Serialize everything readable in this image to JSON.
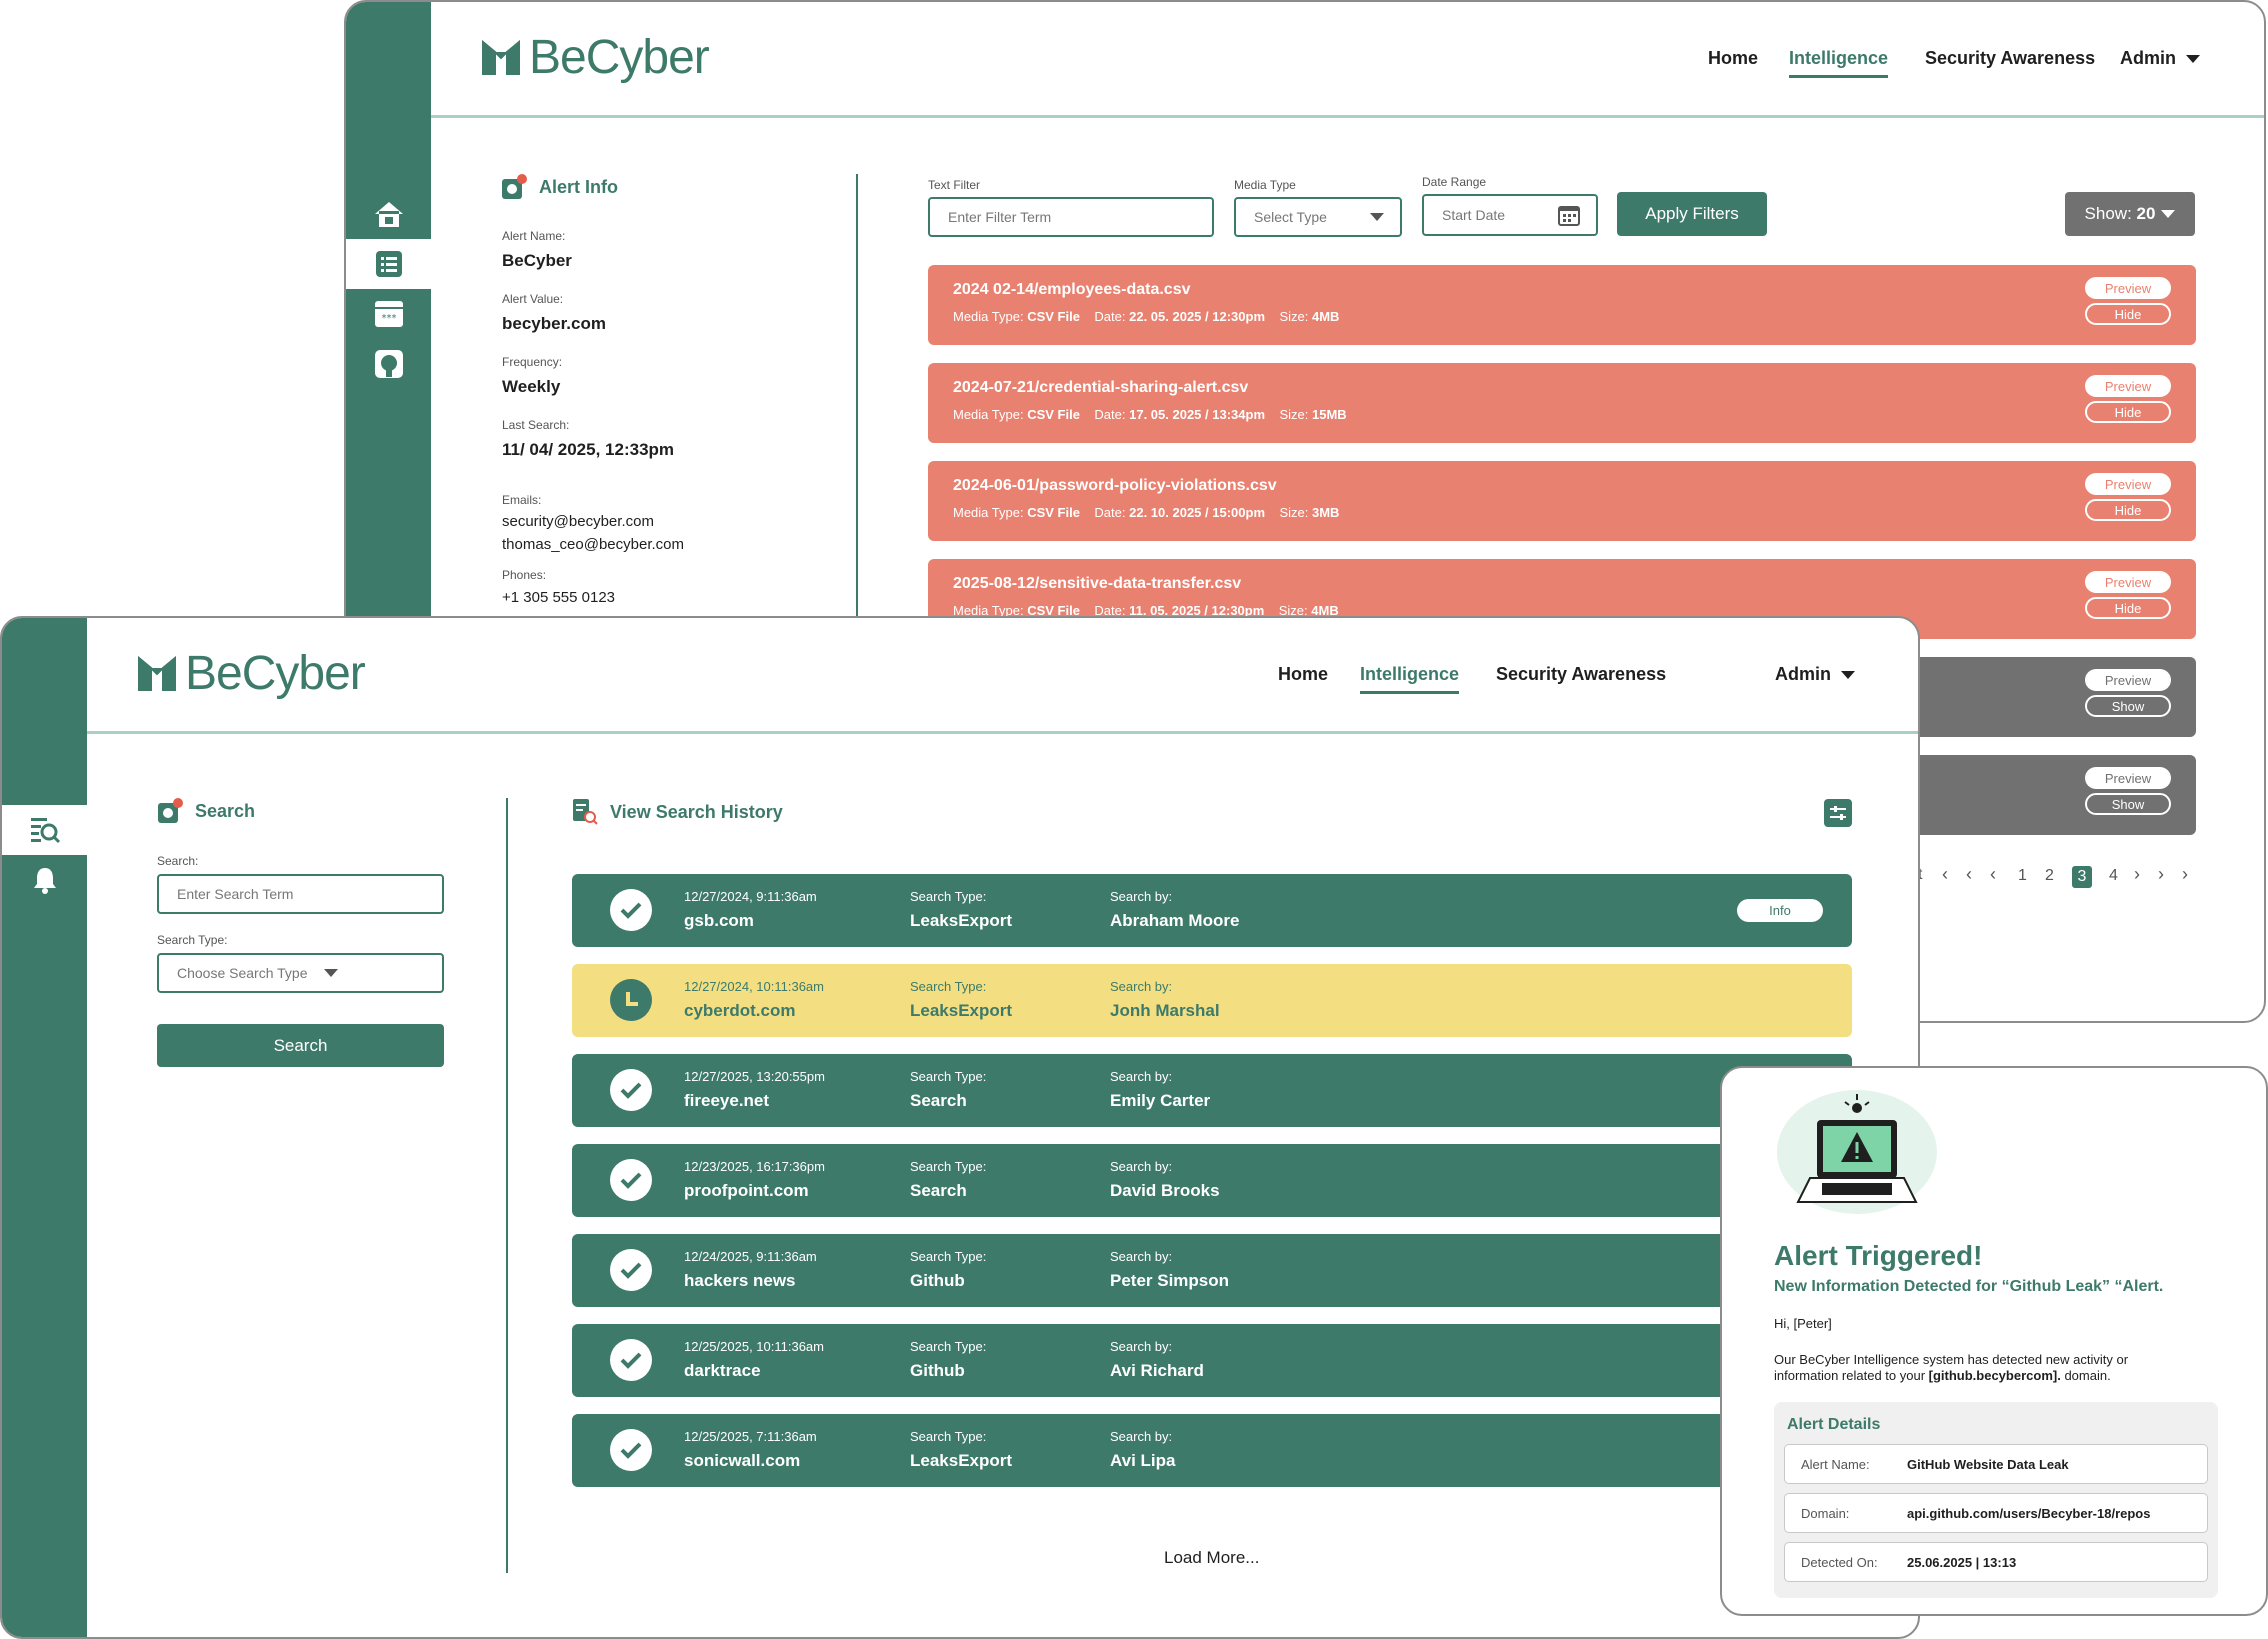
{
  "brand": "BeCyber",
  "nav": {
    "home": "Home",
    "intelligence": "Intelligence",
    "awareness": "Security Awareness",
    "admin": "Admin"
  },
  "alert_info": {
    "title": "Alert Info",
    "name_label": "Alert Name:",
    "name": "BeCyber",
    "value_label": "Alert Value:",
    "value": "becyber.com",
    "freq_label": "Frequency:",
    "freq": "Weekly",
    "last_label": "Last Search:",
    "last": "11/ 04/ 2025, 12:33pm",
    "emails_label": "Emails:",
    "email1": "security@becyber.com",
    "email2": "thomas_ceo@becyber.com",
    "phones_label": "Phones:",
    "phone1": "+1 305 555 0123"
  },
  "filters": {
    "text_label": "Text Filter",
    "text_placeholder": "Enter Filter Term",
    "media_label": "Media Type",
    "media_value": "Select Type",
    "date_label": "Date Range",
    "date_value": "Start Date",
    "apply": "Apply Filters",
    "show_label": "Show:",
    "show_value": "20"
  },
  "files": [
    {
      "name": "2024 02-14/employees-data.csv",
      "media_label": "Media Type:",
      "media": "CSV File",
      "date_label": "Date:",
      "date": "22. 05. 2025 / 12:30pm",
      "size_label": "Size:",
      "size": "4MB",
      "preview": "Preview",
      "action": "Hide"
    },
    {
      "name": "2024-07-21/credential-sharing-alert.csv",
      "media_label": "Media Type:",
      "media": "CSV File",
      "date_label": "Date:",
      "date": "17. 05. 2025 / 13:34pm",
      "size_label": "Size:",
      "size": "15MB",
      "preview": "Preview",
      "action": "Hide"
    },
    {
      "name": "2024-06-01/password-policy-violations.csv",
      "media_label": "Media Type:",
      "media": "CSV File",
      "date_label": "Date:",
      "date": "22. 10. 2025 / 15:00pm",
      "size_label": "Size:",
      "size": "3MB",
      "preview": "Preview",
      "action": "Hide"
    },
    {
      "name": "2025-08-12/sensitive-data-transfer.csv",
      "media_label": "Media Type:",
      "media": "CSV File",
      "date_label": "Date:",
      "date": "11. 05. 2025 / 12:30pm",
      "size_label": "Size:",
      "size": "4MB",
      "preview": "Preview",
      "action": "Hide"
    },
    {
      "preview": "Preview",
      "action": "Show"
    },
    {
      "preview": "Preview",
      "action": "Show"
    }
  ],
  "pagination": {
    "pages": [
      "1",
      "2",
      "3",
      "4"
    ],
    "current": "3",
    "partial": "t"
  },
  "search": {
    "title": "Search",
    "search_label": "Search:",
    "search_placeholder": "Enter Search Term",
    "type_label": "Search Type:",
    "type_placeholder": "Choose Search Type",
    "button": "Search"
  },
  "history": {
    "title": "View Search History",
    "type_label": "Search Type:",
    "by_label": "Search by:",
    "info": "Info",
    "load_more": "Load More...",
    "rows": [
      {
        "time": "12/27/2024, 9:11:36am",
        "domain": "gsb.com",
        "type": "LeaksExport",
        "by": "Abraham Moore",
        "status": "done"
      },
      {
        "time": "12/27/2024, 10:11:36am",
        "domain": "cyberdot.com",
        "type": "LeaksExport",
        "by": "Jonh Marshal",
        "status": "pending"
      },
      {
        "time": "12/27/2025, 13:20:55pm",
        "domain": "fireeye.net",
        "type": "Search",
        "by": "Emily Carter",
        "status": "done"
      },
      {
        "time": "12/23/2025, 16:17:36pm",
        "domain": "proofpoint.com",
        "type": "Search",
        "by": "David Brooks",
        "status": "done"
      },
      {
        "time": "12/24/2025, 9:11:36am",
        "domain": "hackers news",
        "type": "Github",
        "by": "Peter Simpson",
        "status": "done"
      },
      {
        "time": "12/25/2025, 10:11:36am",
        "domain": "darktrace",
        "type": "Github",
        "by": "Avi Richard",
        "status": "done"
      },
      {
        "time": "12/25/2025, 7:11:36am",
        "domain": "sonicwall.com",
        "type": "LeaksExport",
        "by": "Avi Lipa",
        "status": "done"
      }
    ]
  },
  "email": {
    "title": "Alert Triggered!",
    "subtitle": "New Information Detected for “Github Leak” “Alert.",
    "greeting": "Hi, [Peter]",
    "body1": "Our BeCyber Intelligence system has detected new activity or information related to your ",
    "body_domain": "[github.becybercom].",
    "body2": " domain.",
    "details_title": "Alert Details",
    "name_label": "Alert Name:",
    "name": "GitHub Website Data Leak",
    "domain_label": "Domain:",
    "domain": "api.github.com/users/Becyber-18/repos",
    "detected_label": "Detected On:",
    "detected": "25.06.2025 | 13:13"
  },
  "colors": {
    "primary": "#3d7a6a",
    "alert_red": "#e98170",
    "muted_gray": "#717171",
    "pending_yellow": "#f3df82",
    "accent_line": "#a8d1c0"
  }
}
